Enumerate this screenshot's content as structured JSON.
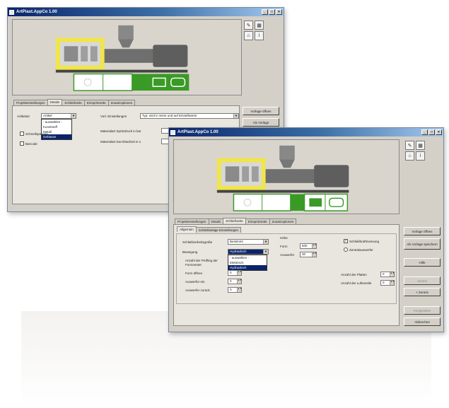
{
  "back_window": {
    "title": "ArtPlast.AppCo 1.00",
    "tabs": [
      "Projekteinstellungen",
      "Details",
      "Schließseite",
      "Einspritzseite",
      "Zusatzoptionen"
    ],
    "active_tab": 1,
    "field1_label": "Artikelart",
    "field1_value": "Artikel",
    "dropdown_options": [
      "- auswählen -",
      "Kunststoff",
      "Metall",
      "Gehäuse"
    ],
    "dropdown_highlight": 3,
    "field2_label": "Vorl. Einstellungen",
    "field2_value": "Typ: wird in Serie und auf Einstellwerte",
    "field3_label": "Materialart Spritzdruck in bar",
    "field4_label": "Materialart Durchlaufzeit in s",
    "check1": "Schnellspannen",
    "check2": "Barcode",
    "btn1": "Vorlage öffnen",
    "btn2": "Als Vorlage"
  },
  "front_window": {
    "title": "ArtPlast.AppCo 1.00",
    "tabs": [
      "Projekteinstellungen",
      "Details",
      "Schließseite",
      "Einspritzseite",
      "Zusatzoptionen"
    ],
    "active_tab": 2,
    "subtabs": [
      "Allgemein",
      "Schließseitige Einstellungen"
    ],
    "active_subtab": 0,
    "schliess_label": "Schließeinheitsgröße",
    "schliess_value": "Bestimmt",
    "bewegung_label": "Bewegung",
    "bewegung_value": "Hydraulisch",
    "dropdown_options": [
      "- auswählen -",
      "Elektrisch",
      "Hydraulisch"
    ],
    "dropdown_highlight": 2,
    "anzahl_label": "Anzahl der Prüfling der Formnester",
    "formoeff_label": "Form öffnen",
    "auswerfer_label": "Auswerfer ein",
    "auswerfer_zurueck_label": "Auswerfer zurück",
    "hoehe_label": "Höhe",
    "form_label": "Form",
    "form_value": "500",
    "auswerfer_label2": "Auswerfer",
    "auswerfer_value": "30",
    "spin_values": [
      "0",
      "0",
      "0"
    ],
    "radio_label": "Zentralauswerfer",
    "check_label": "Schließkraftmessung",
    "check_checked": true,
    "anzahl_platten_label": "Anzahl der Platten",
    "anzahl_luftventile_label": "Anzahl der Luftventile",
    "anzahl_values": [
      "0",
      "0"
    ],
    "buttons": [
      "Vorlage öffnen",
      "Als Vorlage speichern",
      "Hilfe",
      "Zurück",
      "< Zurück",
      "Fertigstellen",
      "Abbrechen"
    ],
    "disabled_buttons": [
      3,
      5
    ]
  },
  "colors": {
    "title_start": "#0a246a",
    "title_end": "#a6caf0",
    "accent_green": "#3a9a26",
    "accent_yellow": "#f0e64a",
    "window_bg": "#d4d0c8"
  },
  "icons": [
    "minimize-icon",
    "maximize-icon",
    "close-icon",
    "pencil-icon",
    "chart-icon",
    "house-icon",
    "info-icon",
    "droplet-icon",
    "screw-icon",
    "mold-icon"
  ]
}
